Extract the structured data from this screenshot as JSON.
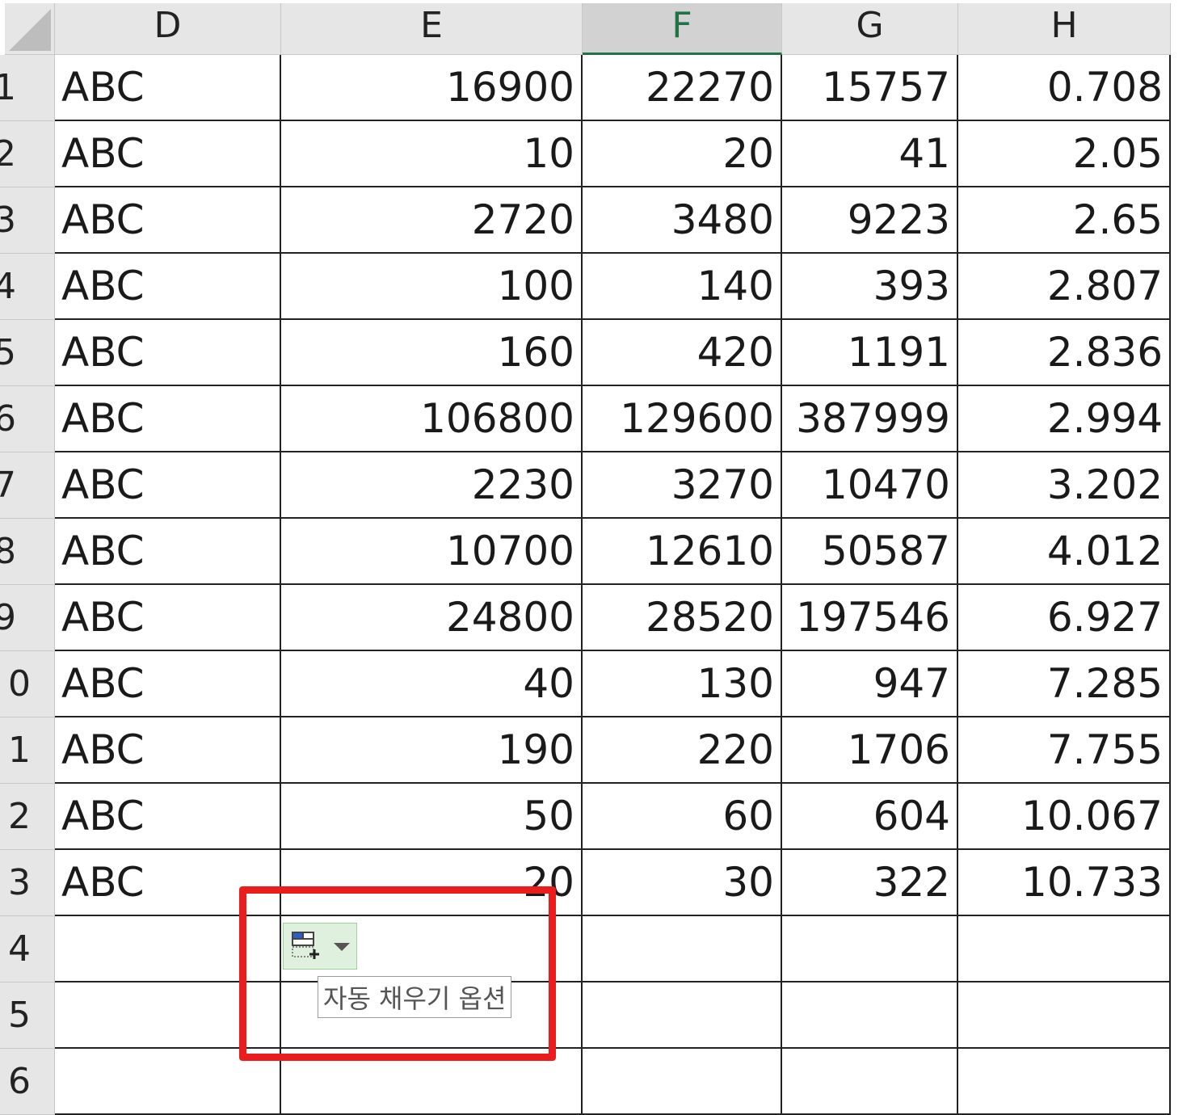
{
  "columns": [
    "D",
    "E",
    "F",
    "G",
    "H"
  ],
  "selected_column": "F",
  "row_headers": [
    "1",
    "2",
    "3",
    "4",
    "5",
    "6",
    "7",
    "8",
    "9",
    "0",
    "1",
    "2",
    "3",
    "4",
    "5",
    "6"
  ],
  "rows": [
    [
      "ABC",
      "16900",
      "22270",
      "15757",
      "0.708"
    ],
    [
      "ABC",
      "10",
      "20",
      "41",
      "2.05"
    ],
    [
      "ABC",
      "2720",
      "3480",
      "9223",
      "2.65"
    ],
    [
      "ABC",
      "100",
      "140",
      "393",
      "2.807"
    ],
    [
      "ABC",
      "160",
      "420",
      "1191",
      "2.836"
    ],
    [
      "ABC",
      "106800",
      "129600",
      "387999",
      "2.994"
    ],
    [
      "ABC",
      "2230",
      "3270",
      "10470",
      "3.202"
    ],
    [
      "ABC",
      "10700",
      "12610",
      "50587",
      "4.012"
    ],
    [
      "ABC",
      "24800",
      "28520",
      "197546",
      "6.927"
    ],
    [
      "ABC",
      "40",
      "130",
      "947",
      "7.285"
    ],
    [
      "ABC",
      "190",
      "220",
      "1706",
      "7.755"
    ],
    [
      "ABC",
      "50",
      "60",
      "604",
      "10.067"
    ],
    [
      "ABC",
      "20",
      "30",
      "322",
      "10.733"
    ],
    [
      "",
      "",
      "",
      "",
      ""
    ],
    [
      "",
      "",
      "",
      "",
      ""
    ],
    [
      "",
      "",
      "",
      "",
      ""
    ]
  ],
  "autofill": {
    "icon": "autofill-options-icon",
    "tooltip": "자동 채우기 옵션"
  },
  "colors": {
    "header_bg": "#e6e6e6",
    "selected_header_text": "#217346",
    "highlight": "#ea1c1c",
    "autofill_bg": "#dff0de"
  }
}
